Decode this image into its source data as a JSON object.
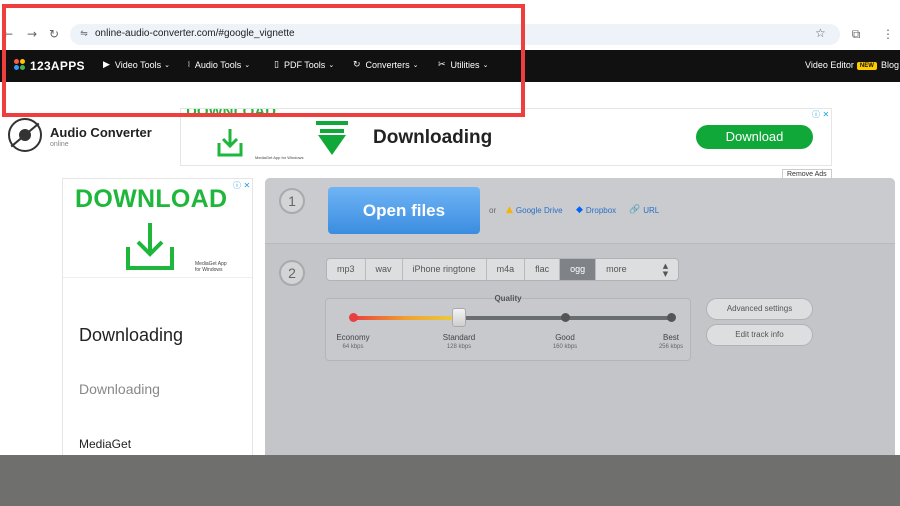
{
  "browser": {
    "url": "online-audio-converter.com/#google_vignette",
    "back_icon": "←",
    "forward_icon": "→",
    "reload_icon": "↻",
    "site_info_icon": "⇋",
    "star_icon": "☆",
    "extensions_icon": "⧉",
    "menu_icon": "⋮"
  },
  "nav": {
    "logo": "123APPS",
    "items": [
      {
        "label": "Video Tools",
        "icon": "▶"
      },
      {
        "label": "Audio Tools",
        "icon": "⧘"
      },
      {
        "label": "PDF Tools",
        "icon": "▯"
      },
      {
        "label": "Converters",
        "icon": "↻"
      },
      {
        "label": "Utilities",
        "icon": "✂"
      }
    ],
    "chevron": "⌄",
    "video_editor": "Video Editor",
    "new_badge": "NEW",
    "blog": "Blog"
  },
  "app": {
    "title": "Audio Converter",
    "subtitle": "online"
  },
  "top_ad": {
    "download_word": "DOWNLOAD",
    "heading": "Downloading",
    "button": "Download",
    "small_print": "MediaGet App for Windows",
    "adchoice": "ⓘ ✕",
    "remove_ads": "Remove Ads"
  },
  "side_ad": {
    "download_word": "DOWNLOAD",
    "small_print_1": "MediaGet App",
    "small_print_2": "for Windows",
    "heading": "Downloading",
    "subheading": "Downloading",
    "brand": "MediaGet",
    "adchoice": "ⓘ ✕"
  },
  "converter": {
    "step1_number": "1",
    "step2_number": "2",
    "open_files": "Open files",
    "or": "or",
    "google_drive": "Google Drive",
    "dropbox": "Dropbox",
    "url": "URL",
    "formats": [
      "mp3",
      "wav",
      "iPhone ringtone",
      "m4a",
      "flac",
      "ogg"
    ],
    "active_format": "ogg",
    "more": "more",
    "quality_label": "Quality",
    "quality_level": 0.333,
    "quality_steps": [
      {
        "name": "Economy",
        "rate": "64 kbps"
      },
      {
        "name": "Standard",
        "rate": "128 kbps"
      },
      {
        "name": "Good",
        "rate": "160 kbps"
      },
      {
        "name": "Best",
        "rate": "256 kbps"
      }
    ],
    "advanced_settings": "Advanced settings",
    "edit_track_info": "Edit track info"
  },
  "colors": {
    "highlight": "#ef3e3e",
    "ad_green": "#1fb73b",
    "open_files_blue": "#3b8de0",
    "nav_bg": "#111111"
  }
}
